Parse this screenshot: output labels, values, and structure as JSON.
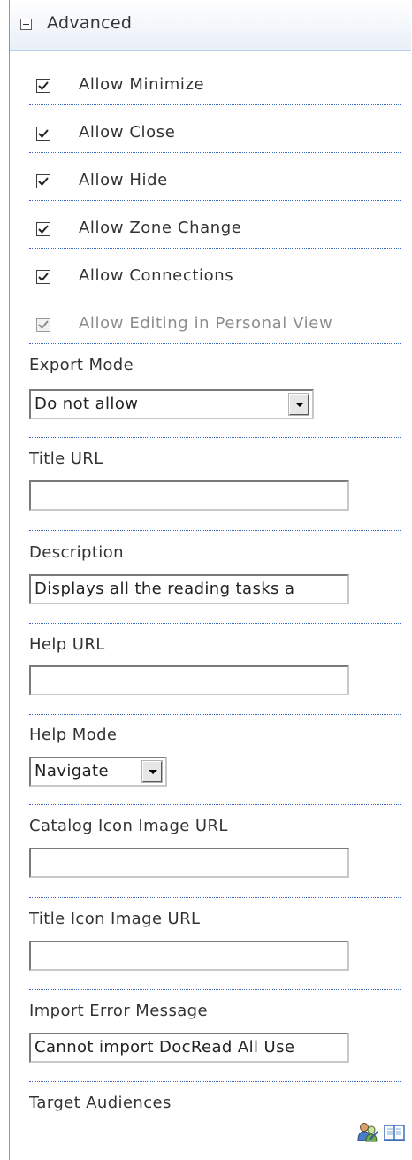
{
  "section": {
    "title": "Advanced"
  },
  "checkboxes": [
    {
      "label": "Allow Minimize",
      "checked": true,
      "disabled": false
    },
    {
      "label": "Allow Close",
      "checked": true,
      "disabled": false
    },
    {
      "label": "Allow Hide",
      "checked": true,
      "disabled": false
    },
    {
      "label": "Allow Zone Change",
      "checked": true,
      "disabled": false
    },
    {
      "label": "Allow Connections",
      "checked": true,
      "disabled": false
    },
    {
      "label": "Allow Editing in Personal View",
      "checked": true,
      "disabled": true
    }
  ],
  "fields": {
    "export_mode": {
      "label": "Export Mode",
      "value": "Do not allow"
    },
    "title_url": {
      "label": "Title URL",
      "value": ""
    },
    "description": {
      "label": "Description",
      "value": "Displays all the reading tasks a"
    },
    "help_url": {
      "label": "Help URL",
      "value": ""
    },
    "help_mode": {
      "label": "Help Mode",
      "value": "Navigate"
    },
    "catalog_icon_url": {
      "label": "Catalog Icon Image URL",
      "value": ""
    },
    "title_icon_url": {
      "label": "Title Icon Image URL",
      "value": ""
    },
    "import_error": {
      "label": "Import Error Message",
      "value": "Cannot import DocRead All Use"
    },
    "target_audiences": {
      "label": "Target Audiences"
    }
  },
  "icons": {
    "people_picker": "people-picker-icon",
    "address_book": "address-book-icon"
  },
  "colors": {
    "panel_border": "#6f9dd9",
    "separator": "#3a67c2",
    "disabled_text": "#8d8d8d"
  }
}
